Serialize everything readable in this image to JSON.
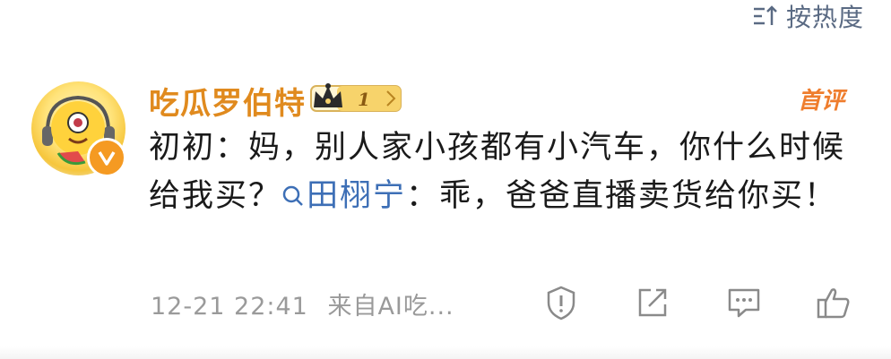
{
  "sort": {
    "label": "按热度",
    "icon": "sort-icon"
  },
  "comment": {
    "username": "吃瓜罗伯特",
    "fan_badge_level": "1",
    "first_comment_tag": "首评",
    "text_before_mention": "初初：妈，别人家小孩都有小汽车，你什么时候给我买？",
    "mention": "田栩宁",
    "text_after_mention": "：乖，爸爸直播卖货给你买！",
    "timestamp": "12-21 22:41",
    "source": "来自AI吃...",
    "actions": [
      "shield-icon",
      "share-icon",
      "comment-icon",
      "like-icon"
    ]
  },
  "colors": {
    "username": "#e08a1e",
    "mention": "#3d6fb6",
    "first_comment": "#ef7d2d",
    "meta": "#9a9a9a",
    "verified": "#f59a22"
  }
}
